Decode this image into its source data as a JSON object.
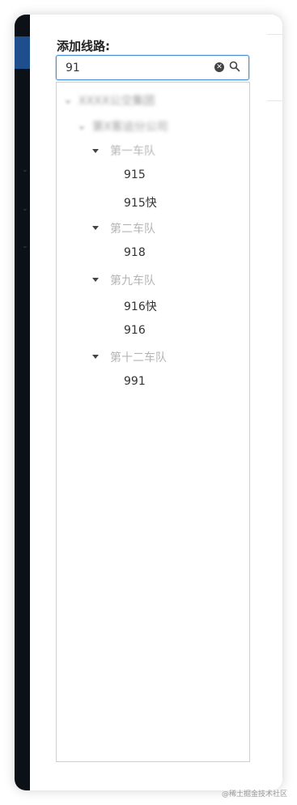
{
  "panel": {
    "title": "添加线路:"
  },
  "search": {
    "value": "91"
  },
  "tree": {
    "root_blurred": "XXXX公交集团",
    "company_blurred": "第X客运分公司",
    "groups": [
      {
        "label": "第一车队",
        "items": [
          "915",
          "915快"
        ]
      },
      {
        "label": "第二车队",
        "items": [
          "918"
        ]
      },
      {
        "label": "第九车队",
        "items": [
          "916快",
          "916"
        ]
      },
      {
        "label": "第十二车队",
        "items": [
          "991"
        ]
      }
    ]
  },
  "watermark": "@稀土掘金技术社区",
  "icons": {
    "clear": "close-circle-icon",
    "search": "search-icon",
    "expand": "caret-down-icon"
  }
}
